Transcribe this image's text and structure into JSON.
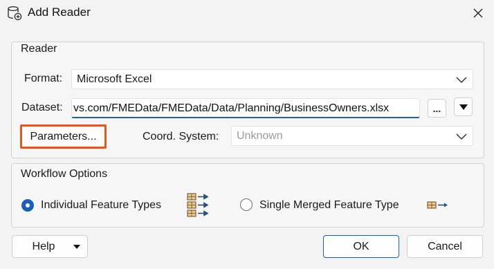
{
  "window": {
    "title": "Add Reader",
    "app_icon": "database-add-icon",
    "close_icon": "close-icon"
  },
  "reader_group": {
    "label": "Reader",
    "format": {
      "label": "Format:",
      "value": "Microsoft Excel"
    },
    "dataset": {
      "label": "Dataset:",
      "value": "vs.com/FMEData/FMEData/Data/Planning/BusinessOwners.xlsx",
      "browse_label": "...",
      "menu_icon": "triangle-down-icon"
    },
    "parameters_label": "Parameters...",
    "coord_system": {
      "label": "Coord. System:",
      "placeholder": "Unknown"
    }
  },
  "workflow_group": {
    "label": "Workflow Options",
    "options": [
      {
        "label": "Individual Feature Types",
        "selected": true,
        "icon": "multiple-feature-types-icon"
      },
      {
        "label": "Single Merged Feature Type",
        "selected": false,
        "icon": "merged-feature-type-icon"
      }
    ]
  },
  "footer": {
    "help_label": "Help",
    "ok_label": "OK",
    "cancel_label": "Cancel"
  },
  "colors": {
    "accent": "#1a5fb4",
    "highlight": "#e8541c",
    "background": "#f3f3f3"
  }
}
